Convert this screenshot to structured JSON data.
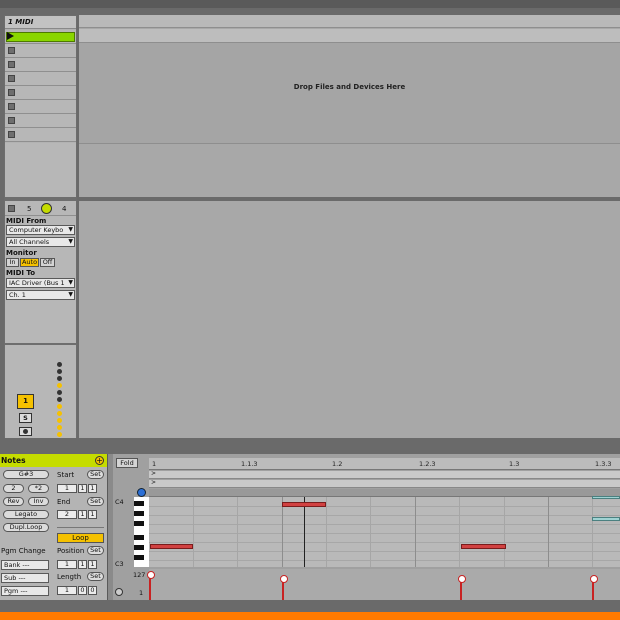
{
  "track": {
    "title": "1 MIDI",
    "number_a": "5",
    "number_b": "4",
    "midi_from_label": "MIDI From",
    "midi_from_value": "Computer Keybo",
    "channels_value": "All Channels",
    "monitor_label": "Monitor",
    "monitor_in": "In",
    "monitor_auto": "Auto",
    "monitor_off": "Off",
    "midi_to_label": "MIDI To",
    "midi_to_value": "IAC Driver (Bus 1",
    "channel_value": "Ch. 1",
    "track_number": "1",
    "solo": "S"
  },
  "arrangement": {
    "drop_text": "Drop Files and Devices Here"
  },
  "notes_panel": {
    "title": "Notes",
    "note_name": "G#3",
    "start_label": "Start",
    "set_label": "Set",
    "div2": "2",
    "mul2": "*2",
    "rev": "Rev",
    "inv": "Inv",
    "end_label": "End",
    "legato": "Legato",
    "dupl_loop": "Dupl.Loop",
    "loop": "Loop",
    "pgm_change": "Pgm Change",
    "position_label": "Position",
    "bank": "Bank ---",
    "sub": "Sub ---",
    "pgm": "Pgm ---",
    "length_label": "Length",
    "start_vals": [
      "1",
      "1",
      "1"
    ],
    "end_vals": [
      "2",
      "1",
      "1"
    ],
    "position_vals": [
      "1",
      "1",
      "1"
    ],
    "length_vals": [
      "1",
      "0",
      "0"
    ]
  },
  "piano_roll": {
    "fold": "Fold",
    "ruler_ticks": [
      "1",
      "1.1.3",
      "1.2",
      "1.2.3",
      "1.3",
      "1.3.3"
    ],
    "c4": "C4",
    "c3": "C3",
    "vel_top": "127",
    "vel_bottom": "1"
  }
}
